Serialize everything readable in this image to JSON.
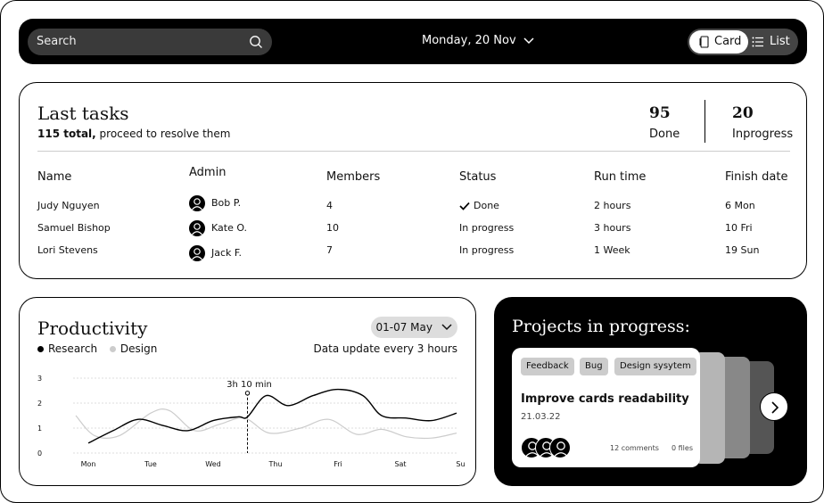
{
  "topbar": {
    "search_placeholder": "Search",
    "date_label": "Monday, 20 Nov",
    "view_card_label": "Card",
    "view_list_label": "List"
  },
  "tasks": {
    "title": "Last tasks",
    "total_bold": "115 total,",
    "total_rest": " proceed to resolve them",
    "done_count": "95",
    "done_label": "Done",
    "inprogress_count": "20",
    "inprogress_label": "Inprogress",
    "columns": [
      "Name",
      "Admin",
      "Members",
      "Status",
      "Run time",
      "Finish date"
    ],
    "rows": [
      {
        "name": "Judy Nguyen",
        "admin": "Bob P.",
        "members": "4",
        "status": "Done",
        "runtime": "2 hours",
        "finish": "6 Mon"
      },
      {
        "name": "Samuel Bishop",
        "admin": "Kate O.",
        "members": "10",
        "status": "In progress",
        "runtime": "3 hours",
        "finish": "10 Fri"
      },
      {
        "name": "Lori Stevens",
        "admin": "Jack F.",
        "members": "7",
        "status": "In progress",
        "runtime": "1 Week",
        "finish": "19 Sun"
      }
    ]
  },
  "productivity": {
    "title": "Productivity",
    "legend_research": "Research",
    "legend_design": "Design",
    "range_label": "01-07 May",
    "update_note": "Data update every 3 hours",
    "tooltip": "3h 10 min"
  },
  "chart_data": {
    "type": "line",
    "x": [
      "Mon",
      "Tue",
      "Wed",
      "Thu",
      "Fri",
      "Sat",
      "Sun"
    ],
    "ylim": [
      0,
      3
    ],
    "yticks": [
      "0",
      "1",
      "2",
      "3"
    ],
    "series": [
      {
        "name": "Research",
        "color": "#000000",
        "points": [
          [
            0,
            0.4
          ],
          [
            0.4,
            0.9
          ],
          [
            0.8,
            1.35
          ],
          [
            1.2,
            1.1
          ],
          [
            1.6,
            0.9
          ],
          [
            2.0,
            1.3
          ],
          [
            2.4,
            1.45
          ],
          [
            2.55,
            1.45
          ],
          [
            2.85,
            2.3
          ],
          [
            3.2,
            1.9
          ],
          [
            3.6,
            2.3
          ],
          [
            4.0,
            2.55
          ],
          [
            4.4,
            2.3
          ],
          [
            4.7,
            1.5
          ],
          [
            5.1,
            1.4
          ],
          [
            5.5,
            1.3
          ],
          [
            5.9,
            1.6
          ]
        ]
      },
      {
        "name": "Design",
        "color": "#cccccc",
        "points": [
          [
            -0.2,
            1.5
          ],
          [
            0.1,
            0.7
          ],
          [
            0.5,
            0.7
          ],
          [
            1.0,
            1.6
          ],
          [
            1.3,
            1.7
          ],
          [
            1.7,
            0.9
          ],
          [
            2.1,
            1.15
          ],
          [
            2.5,
            1.4
          ],
          [
            2.9,
            0.8
          ],
          [
            3.4,
            1.0
          ],
          [
            3.85,
            1.35
          ],
          [
            4.3,
            0.75
          ],
          [
            4.7,
            0.95
          ],
          [
            5.1,
            0.65
          ],
          [
            5.5,
            0.6
          ],
          [
            5.9,
            0.8
          ]
        ]
      }
    ],
    "marker": {
      "x": 2.55,
      "y": 2.4,
      "label": "3h 10 min"
    },
    "grid": true,
    "legend": "top-left"
  },
  "projects": {
    "title": "Projects in progress:",
    "tags": [
      "Feedback",
      "Bug",
      "Design sysytem"
    ],
    "card_title": "Improve cards readability",
    "card_date": "21.03.22",
    "comments": "12 comments",
    "files": "0 files"
  },
  "icons": {
    "search": "search-icon",
    "chevron": "chevron-down-icon",
    "card_view": "card-icon",
    "list_view": "list-icon",
    "check": "check-icon",
    "avatar": "user-avatar-icon",
    "next": "chevron-right-icon"
  }
}
